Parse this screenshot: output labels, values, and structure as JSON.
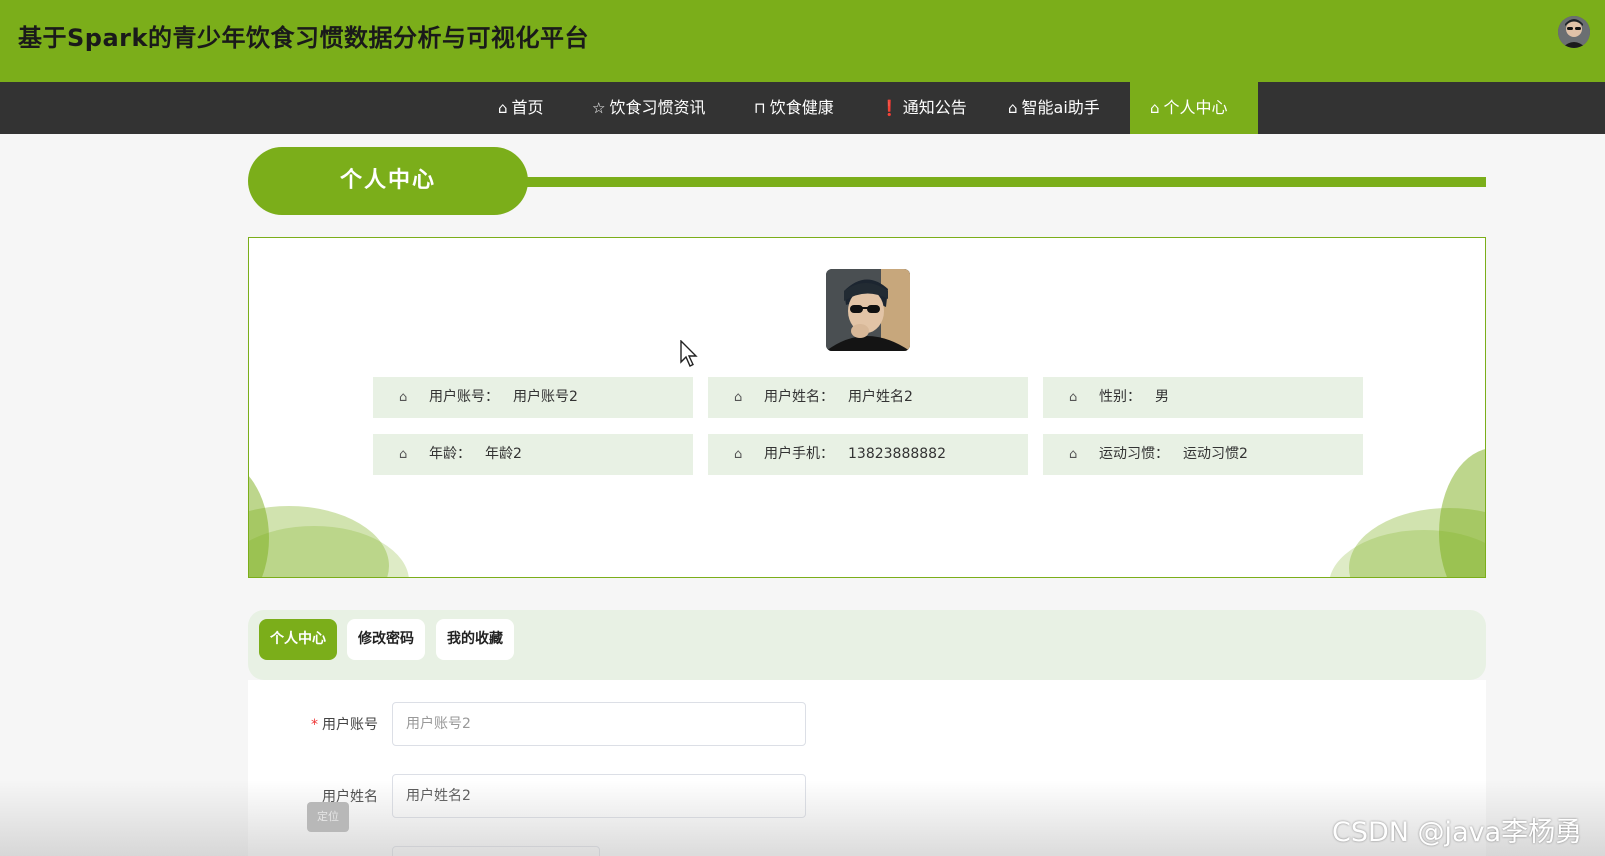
{
  "header": {
    "site_title": "基于Spark的青少年饮食习惯数据分析与可视化平台"
  },
  "nav": {
    "items": [
      {
        "label": "首页",
        "icon": "home-icon",
        "glyph": "⌂"
      },
      {
        "label": "饮食习惯资讯",
        "icon": "star-icon",
        "glyph": "☆"
      },
      {
        "label": "饮食健康",
        "icon": "bag-icon",
        "glyph": "⊓"
      },
      {
        "label": "通知公告",
        "icon": "alert-icon",
        "glyph": "❗"
      },
      {
        "label": "智能ai助手",
        "icon": "home-icon",
        "glyph": "⌂"
      },
      {
        "label": "个人中心",
        "icon": "home-icon",
        "glyph": "⌂"
      }
    ],
    "active_index": 5
  },
  "section": {
    "title": "个人中心"
  },
  "profile": {
    "fields": [
      {
        "label": "用户账号：",
        "value": "用户账号2"
      },
      {
        "label": "用户姓名：",
        "value": "用户姓名2"
      },
      {
        "label": "性别：",
        "value": "男"
      },
      {
        "label": "年龄：",
        "value": "年龄2"
      },
      {
        "label": "用户手机：",
        "value": "13823888882"
      },
      {
        "label": "运动习惯：",
        "value": "运动习惯2"
      }
    ]
  },
  "tabs": {
    "items": [
      "个人中心",
      "修改密码",
      "我的收藏"
    ],
    "active_index": 0
  },
  "form": {
    "account_label": "用户账号",
    "account_required": "*",
    "account_placeholder": "用户账号2",
    "name_label": "用户姓名",
    "name_value": "用户姓名2"
  },
  "floating": {
    "locate_label": "定位"
  },
  "watermark": "CSDN @java李杨勇",
  "colors": {
    "brand_green": "#7bae1a",
    "nav_dark": "#333333",
    "cell_bg": "#e8f1e4"
  }
}
